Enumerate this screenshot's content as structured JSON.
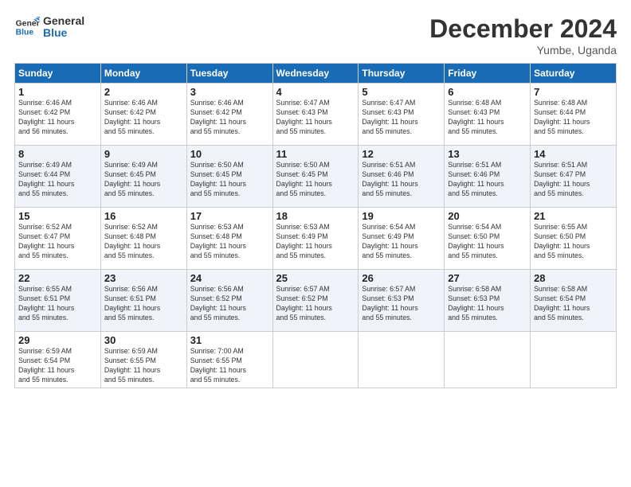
{
  "header": {
    "logo_line1": "General",
    "logo_line2": "Blue",
    "month_title": "December 2024",
    "location": "Yumbe, Uganda"
  },
  "days_of_week": [
    "Sunday",
    "Monday",
    "Tuesday",
    "Wednesday",
    "Thursday",
    "Friday",
    "Saturday"
  ],
  "weeks": [
    [
      {
        "day": "1",
        "sunrise": "6:46 AM",
        "sunset": "6:42 PM",
        "daylight": "11 hours and 56 minutes."
      },
      {
        "day": "2",
        "sunrise": "6:46 AM",
        "sunset": "6:42 PM",
        "daylight": "11 hours and 55 minutes."
      },
      {
        "day": "3",
        "sunrise": "6:46 AM",
        "sunset": "6:42 PM",
        "daylight": "11 hours and 55 minutes."
      },
      {
        "day": "4",
        "sunrise": "6:47 AM",
        "sunset": "6:43 PM",
        "daylight": "11 hours and 55 minutes."
      },
      {
        "day": "5",
        "sunrise": "6:47 AM",
        "sunset": "6:43 PM",
        "daylight": "11 hours and 55 minutes."
      },
      {
        "day": "6",
        "sunrise": "6:48 AM",
        "sunset": "6:43 PM",
        "daylight": "11 hours and 55 minutes."
      },
      {
        "day": "7",
        "sunrise": "6:48 AM",
        "sunset": "6:44 PM",
        "daylight": "11 hours and 55 minutes."
      }
    ],
    [
      {
        "day": "8",
        "sunrise": "6:49 AM",
        "sunset": "6:44 PM",
        "daylight": "11 hours and 55 minutes."
      },
      {
        "day": "9",
        "sunrise": "6:49 AM",
        "sunset": "6:45 PM",
        "daylight": "11 hours and 55 minutes."
      },
      {
        "day": "10",
        "sunrise": "6:50 AM",
        "sunset": "6:45 PM",
        "daylight": "11 hours and 55 minutes."
      },
      {
        "day": "11",
        "sunrise": "6:50 AM",
        "sunset": "6:45 PM",
        "daylight": "11 hours and 55 minutes."
      },
      {
        "day": "12",
        "sunrise": "6:51 AM",
        "sunset": "6:46 PM",
        "daylight": "11 hours and 55 minutes."
      },
      {
        "day": "13",
        "sunrise": "6:51 AM",
        "sunset": "6:46 PM",
        "daylight": "11 hours and 55 minutes."
      },
      {
        "day": "14",
        "sunrise": "6:51 AM",
        "sunset": "6:47 PM",
        "daylight": "11 hours and 55 minutes."
      }
    ],
    [
      {
        "day": "15",
        "sunrise": "6:52 AM",
        "sunset": "6:47 PM",
        "daylight": "11 hours and 55 minutes."
      },
      {
        "day": "16",
        "sunrise": "6:52 AM",
        "sunset": "6:48 PM",
        "daylight": "11 hours and 55 minutes."
      },
      {
        "day": "17",
        "sunrise": "6:53 AM",
        "sunset": "6:48 PM",
        "daylight": "11 hours and 55 minutes."
      },
      {
        "day": "18",
        "sunrise": "6:53 AM",
        "sunset": "6:49 PM",
        "daylight": "11 hours and 55 minutes."
      },
      {
        "day": "19",
        "sunrise": "6:54 AM",
        "sunset": "6:49 PM",
        "daylight": "11 hours and 55 minutes."
      },
      {
        "day": "20",
        "sunrise": "6:54 AM",
        "sunset": "6:50 PM",
        "daylight": "11 hours and 55 minutes."
      },
      {
        "day": "21",
        "sunrise": "6:55 AM",
        "sunset": "6:50 PM",
        "daylight": "11 hours and 55 minutes."
      }
    ],
    [
      {
        "day": "22",
        "sunrise": "6:55 AM",
        "sunset": "6:51 PM",
        "daylight": "11 hours and 55 minutes."
      },
      {
        "day": "23",
        "sunrise": "6:56 AM",
        "sunset": "6:51 PM",
        "daylight": "11 hours and 55 minutes."
      },
      {
        "day": "24",
        "sunrise": "6:56 AM",
        "sunset": "6:52 PM",
        "daylight": "11 hours and 55 minutes."
      },
      {
        "day": "25",
        "sunrise": "6:57 AM",
        "sunset": "6:52 PM",
        "daylight": "11 hours and 55 minutes."
      },
      {
        "day": "26",
        "sunrise": "6:57 AM",
        "sunset": "6:53 PM",
        "daylight": "11 hours and 55 minutes."
      },
      {
        "day": "27",
        "sunrise": "6:58 AM",
        "sunset": "6:53 PM",
        "daylight": "11 hours and 55 minutes."
      },
      {
        "day": "28",
        "sunrise": "6:58 AM",
        "sunset": "6:54 PM",
        "daylight": "11 hours and 55 minutes."
      }
    ],
    [
      {
        "day": "29",
        "sunrise": "6:59 AM",
        "sunset": "6:54 PM",
        "daylight": "11 hours and 55 minutes."
      },
      {
        "day": "30",
        "sunrise": "6:59 AM",
        "sunset": "6:55 PM",
        "daylight": "11 hours and 55 minutes."
      },
      {
        "day": "31",
        "sunrise": "7:00 AM",
        "sunset": "6:55 PM",
        "daylight": "11 hours and 55 minutes."
      },
      null,
      null,
      null,
      null
    ]
  ],
  "labels": {
    "sunrise": "Sunrise:",
    "sunset": "Sunset:",
    "daylight": "Daylight:"
  }
}
